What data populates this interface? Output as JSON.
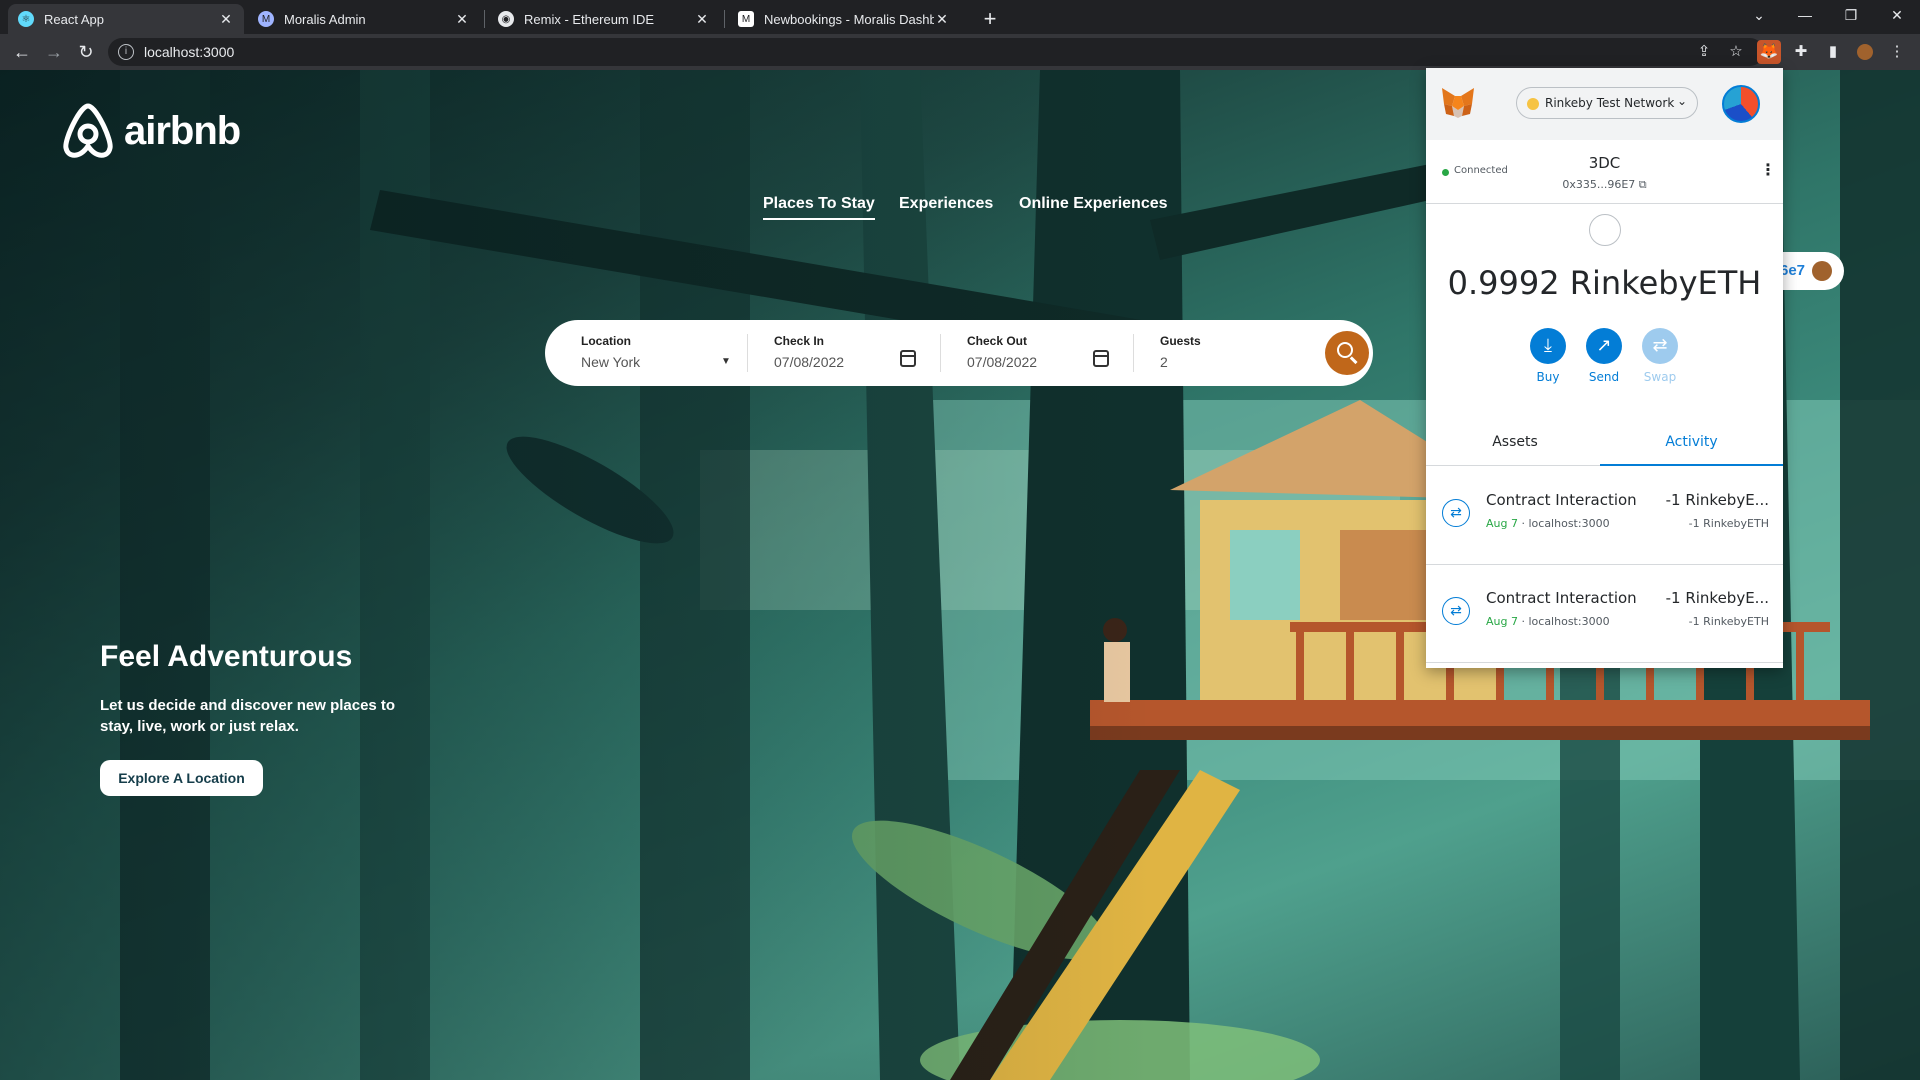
{
  "browser": {
    "tabs": [
      {
        "title": "React App",
        "active": true,
        "icon": "react-icon",
        "color": "#61dafb"
      },
      {
        "title": "Moralis Admin",
        "active": false,
        "icon": "moralis-icon",
        "color": "#9fb4ff"
      },
      {
        "title": "Remix - Ethereum IDE",
        "active": false,
        "icon": "remix-icon",
        "color": "#e8eaed"
      },
      {
        "title": "Newbookings - Moralis Dashboa",
        "active": false,
        "icon": "moralis-dashboard-icon",
        "color": "#ffffff"
      }
    ],
    "url": "localhost:3000"
  },
  "site": {
    "logo": "airbnb",
    "nav": [
      "Places To Stay",
      "Experiences",
      "Online Experiences"
    ],
    "search": {
      "location_label": "Location",
      "location_value": "New York",
      "checkin_label": "Check In",
      "checkin_value": "07/08/2022",
      "checkout_label": "Check Out",
      "checkout_value": "07/08/2022",
      "guests_label": "Guests",
      "guests_value": "2"
    },
    "hero_title": "Feel Adventurous",
    "hero_sub": "Let us decide and discover new places to stay, live, work or just relax.",
    "explore_button": "Explore A Location",
    "connect_partial": "6e7"
  },
  "metamask": {
    "network": "Rinkeby Test Network",
    "connected": "Connected",
    "account_name": "3DC",
    "address": "0x335...96E7",
    "balance": "0.9992 RinkebyETH",
    "actions": [
      "Buy",
      "Send",
      "Swap"
    ],
    "tabs": [
      "Assets",
      "Activity"
    ],
    "activity": [
      {
        "title": "Contract Interaction",
        "date": "Aug 7",
        "origin": "localhost:3000",
        "amount": "-1 RinkebyE...",
        "sub_amount": "-1 RinkebyETH"
      },
      {
        "title": "Contract Interaction",
        "date": "Aug 7",
        "origin": "localhost:3000",
        "amount": "-1 RinkebyE...",
        "sub_amount": "-1 RinkebyETH"
      }
    ]
  },
  "colors": {
    "search_button": "#c0671a",
    "metamask_blue": "#037dd6",
    "network_dot": "#f6c343"
  }
}
